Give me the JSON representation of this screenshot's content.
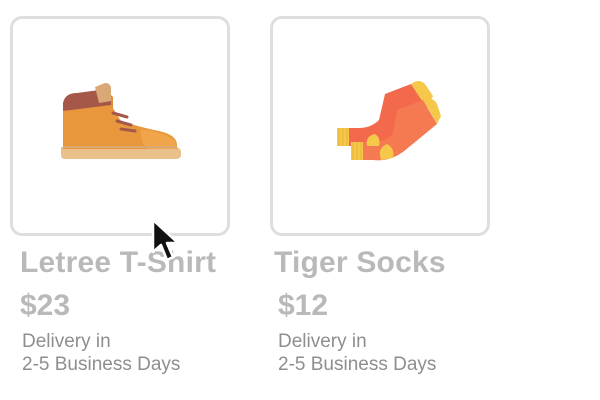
{
  "products": [
    {
      "name": "Letree T-Shirt",
      "price": "$23",
      "delivery_line1": "Delivery in",
      "delivery_line2": "2-5 Business Days",
      "image_icon": "boot-icon"
    },
    {
      "name": "Tiger Socks",
      "price": "$12",
      "delivery_line1": "Delivery in",
      "delivery_line2": "2-5 Business Days",
      "image_icon": "socks-icon"
    }
  ],
  "colors": {
    "card_border": "#dedede",
    "name_text": "#b9b9b9",
    "price_text": "#b9b9b9",
    "delivery_text": "#8e8e8e",
    "boot_primary": "#e8973c",
    "boot_sole": "#e9c08a",
    "sock_primary": "#f26a4b",
    "sock_accent": "#f6c84a"
  }
}
